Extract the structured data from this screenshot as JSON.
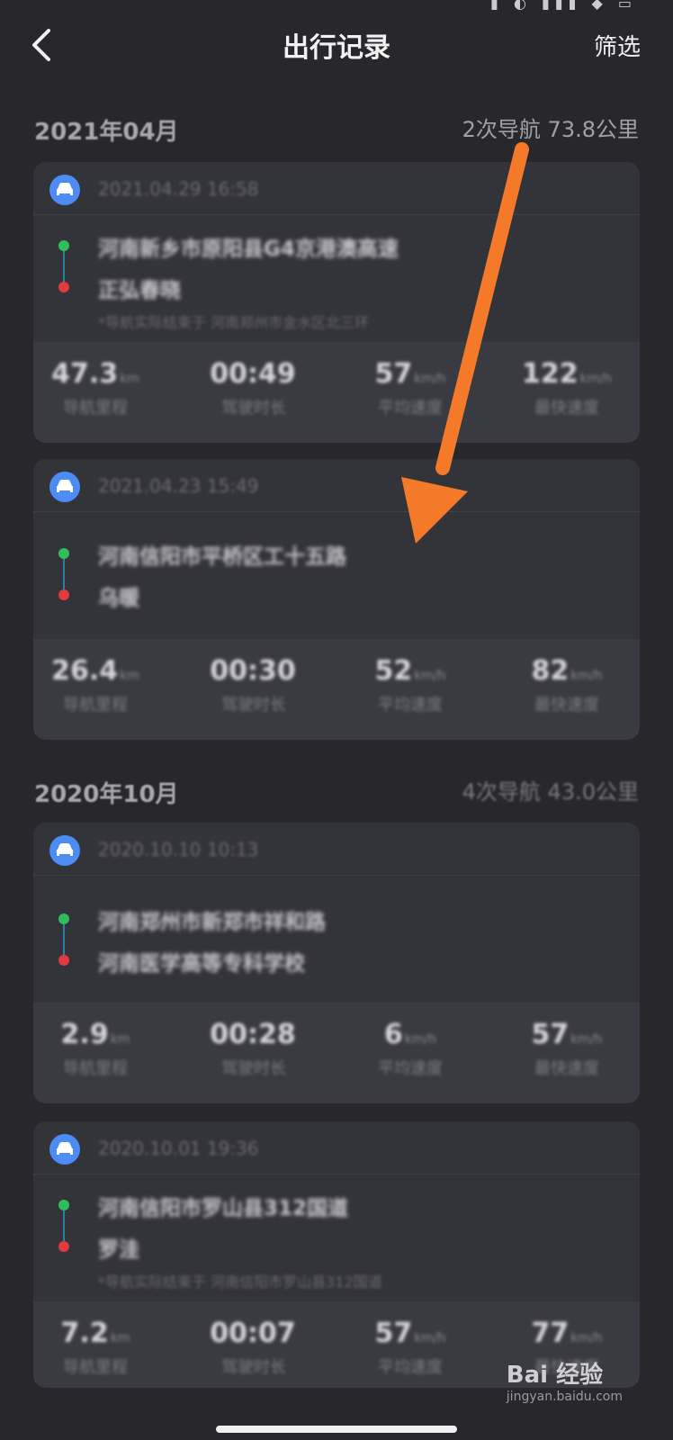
{
  "status_bar": {
    "icons": "▮ ◐ ▮▮▮ ◆ ▭"
  },
  "header": {
    "title": "出行记录",
    "filter_label": "筛选"
  },
  "months": [
    {
      "label": "2021年04月",
      "summary": "2次导航 73.8公里"
    },
    {
      "label": "2020年10月",
      "summary": "4次导航 43.0公里"
    }
  ],
  "stat_labels": [
    "导航里程",
    "驾驶时长",
    "平均速度",
    "最快速度"
  ],
  "trips": [
    {
      "time": "2021.04.29 16:58",
      "start": "河南新乡市原阳县G4京港澳高速",
      "end": "正弘春晓",
      "note": "*导航实际结束于 河南郑州市金水区北三环",
      "stats": [
        {
          "value": "47.3",
          "unit": "km"
        },
        {
          "value": "00:49",
          "unit": ""
        },
        {
          "value": "57",
          "unit": "km/h"
        },
        {
          "value": "122",
          "unit": "km/h"
        }
      ]
    },
    {
      "time": "2021.04.23 15:49",
      "start": "河南信阳市平桥区工十五路",
      "end": "乌暖",
      "note": "",
      "stats": [
        {
          "value": "26.4",
          "unit": "km"
        },
        {
          "value": "00:30",
          "unit": ""
        },
        {
          "value": "52",
          "unit": "km/h"
        },
        {
          "value": "82",
          "unit": "km/h"
        }
      ]
    },
    {
      "time": "2020.10.10 10:13",
      "start": "河南郑州市新郑市祥和路",
      "end": "河南医学高等专科学校",
      "note": "",
      "stats": [
        {
          "value": "2.9",
          "unit": "km"
        },
        {
          "value": "00:28",
          "unit": ""
        },
        {
          "value": "6",
          "unit": "km/h"
        },
        {
          "value": "57",
          "unit": "km/h"
        }
      ]
    },
    {
      "time": "2020.10.01 19:36",
      "start": "河南信阳市罗山县312国道",
      "end": "罗洼",
      "note": "*导航实际结束于 河南信阳市罗山县312国道",
      "stats": [
        {
          "value": "7.2",
          "unit": "km"
        },
        {
          "value": "00:07",
          "unit": ""
        },
        {
          "value": "57",
          "unit": "km/h"
        },
        {
          "value": "77",
          "unit": "km/h"
        }
      ]
    }
  ],
  "annotation": {
    "color": "#f47a2a"
  },
  "watermark": {
    "text": "Bai 经验",
    "sub": "jingyan.baidu.com"
  },
  "colors": {
    "accent": "#4d8cf5",
    "start_dot": "#2fbf5a",
    "end_dot": "#e33a3e"
  }
}
